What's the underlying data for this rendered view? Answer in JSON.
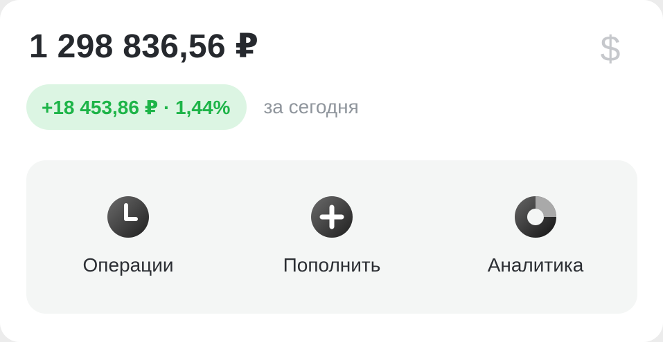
{
  "balance": {
    "amount": "1 298 836,56 ₽"
  },
  "currency_toggle": {
    "symbol": "$",
    "icon": "dollar-icon"
  },
  "change": {
    "value": "+18 453,86 ₽ · 1,44%",
    "period": "за сегодня",
    "color": "#1db448",
    "background": "#dcf5e3"
  },
  "actions": [
    {
      "label": "Операции",
      "icon": "clock-icon"
    },
    {
      "label": "Пополнить",
      "icon": "plus-circle-icon"
    },
    {
      "label": "Аналитика",
      "icon": "donut-chart-icon"
    }
  ]
}
